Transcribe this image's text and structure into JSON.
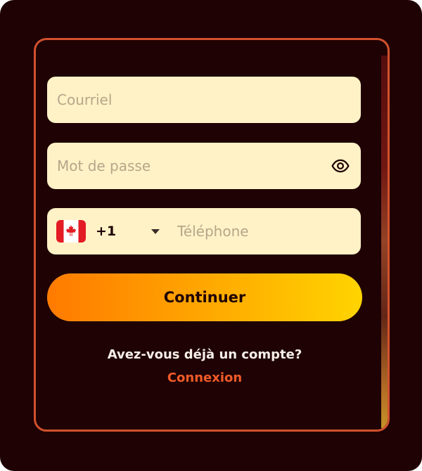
{
  "form": {
    "email": {
      "placeholder": "Courriel",
      "value": ""
    },
    "password": {
      "placeholder": "Mot de passe",
      "value": "",
      "toggle_icon": "eye-icon"
    },
    "phone": {
      "country_flag_icon": "canada-flag-icon",
      "dial_code": "+1",
      "placeholder": "Téléphone",
      "value": ""
    },
    "continue_label": "Continuer"
  },
  "footer": {
    "prompt": "Avez-vous déjà un compte?",
    "login_link": "Connexion"
  },
  "colors": {
    "page_background": "#1f0204",
    "card_border": "#d1512d",
    "field_background": "#fff2c6",
    "button_gradient_start": "#ff7a00",
    "button_gradient_end": "#ffd400",
    "link": "#f05a28"
  }
}
